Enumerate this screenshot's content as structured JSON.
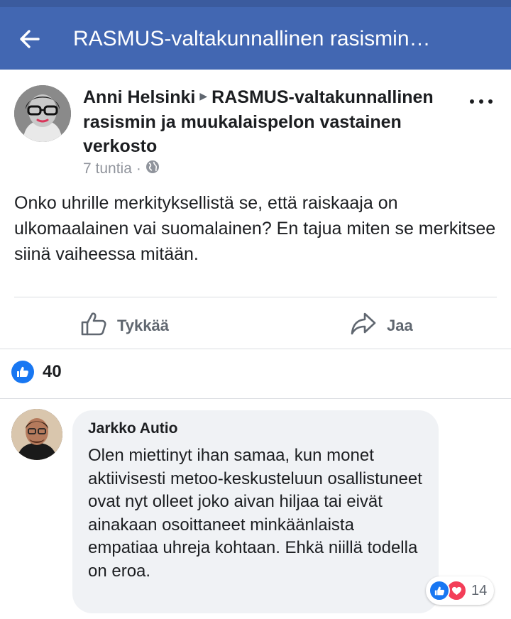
{
  "header": {
    "title": "RASMUS-valtakunnallinen rasismin…",
    "back_icon": "back-arrow-icon"
  },
  "post": {
    "author": "Anni Helsinki",
    "target": "RASMUS-valtakunnallinen rasismin ja muukalaispelon vastainen verkosto",
    "time": "7 tuntia",
    "separator": "·",
    "privacy_icon": "globe-icon",
    "body": "Onko uhrille merkityksellistä se, että raiskaaja on ulkomaalainen vai suomalainen? En tajua miten se merkitsee siinä vaiheessa mitään.",
    "actions": {
      "like_label": "Tykkää",
      "share_label": "Jaa"
    },
    "reaction_count": "40"
  },
  "comment": {
    "author": "Jarkko Autio",
    "text": "Olen miettinyt ihan samaa, kun monet aktiivisesti metoo-keskusteluun osallistuneet ovat nyt olleet joko aivan hiljaa tai eivät ainakaan osoittaneet minkäänlaista empatiaa uhreja kohtaan. Ehkä niillä todella on eroa.",
    "reaction_count": "14"
  },
  "colors": {
    "brand": "#4267b2",
    "like_blue": "#1877f2",
    "love_red": "#f33e58",
    "muted": "#606770"
  }
}
